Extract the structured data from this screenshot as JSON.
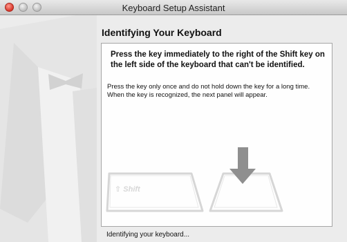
{
  "window": {
    "title": "Keyboard Setup Assistant"
  },
  "page": {
    "title": "Identifying Your Keyboard"
  },
  "panel": {
    "instruction": "Press the key immediately to the right of the Shift key on the left side of the keyboard that can't be identified.",
    "detail": "Press the key only once and do not hold down the key for a long time. When the key is recognized, the next panel will appear.",
    "shift_key_label": "⇧ Shift"
  },
  "status": {
    "text": "Identifying your keyboard..."
  },
  "icons": {
    "close": "close-icon",
    "minimize": "minimize-icon",
    "zoom": "zoom-icon",
    "arrow": "down-arrow-icon"
  },
  "colors": {
    "close_button": "#d8362a",
    "arrow": "#8f8f8f",
    "key_outline": "#d6d6d6"
  }
}
